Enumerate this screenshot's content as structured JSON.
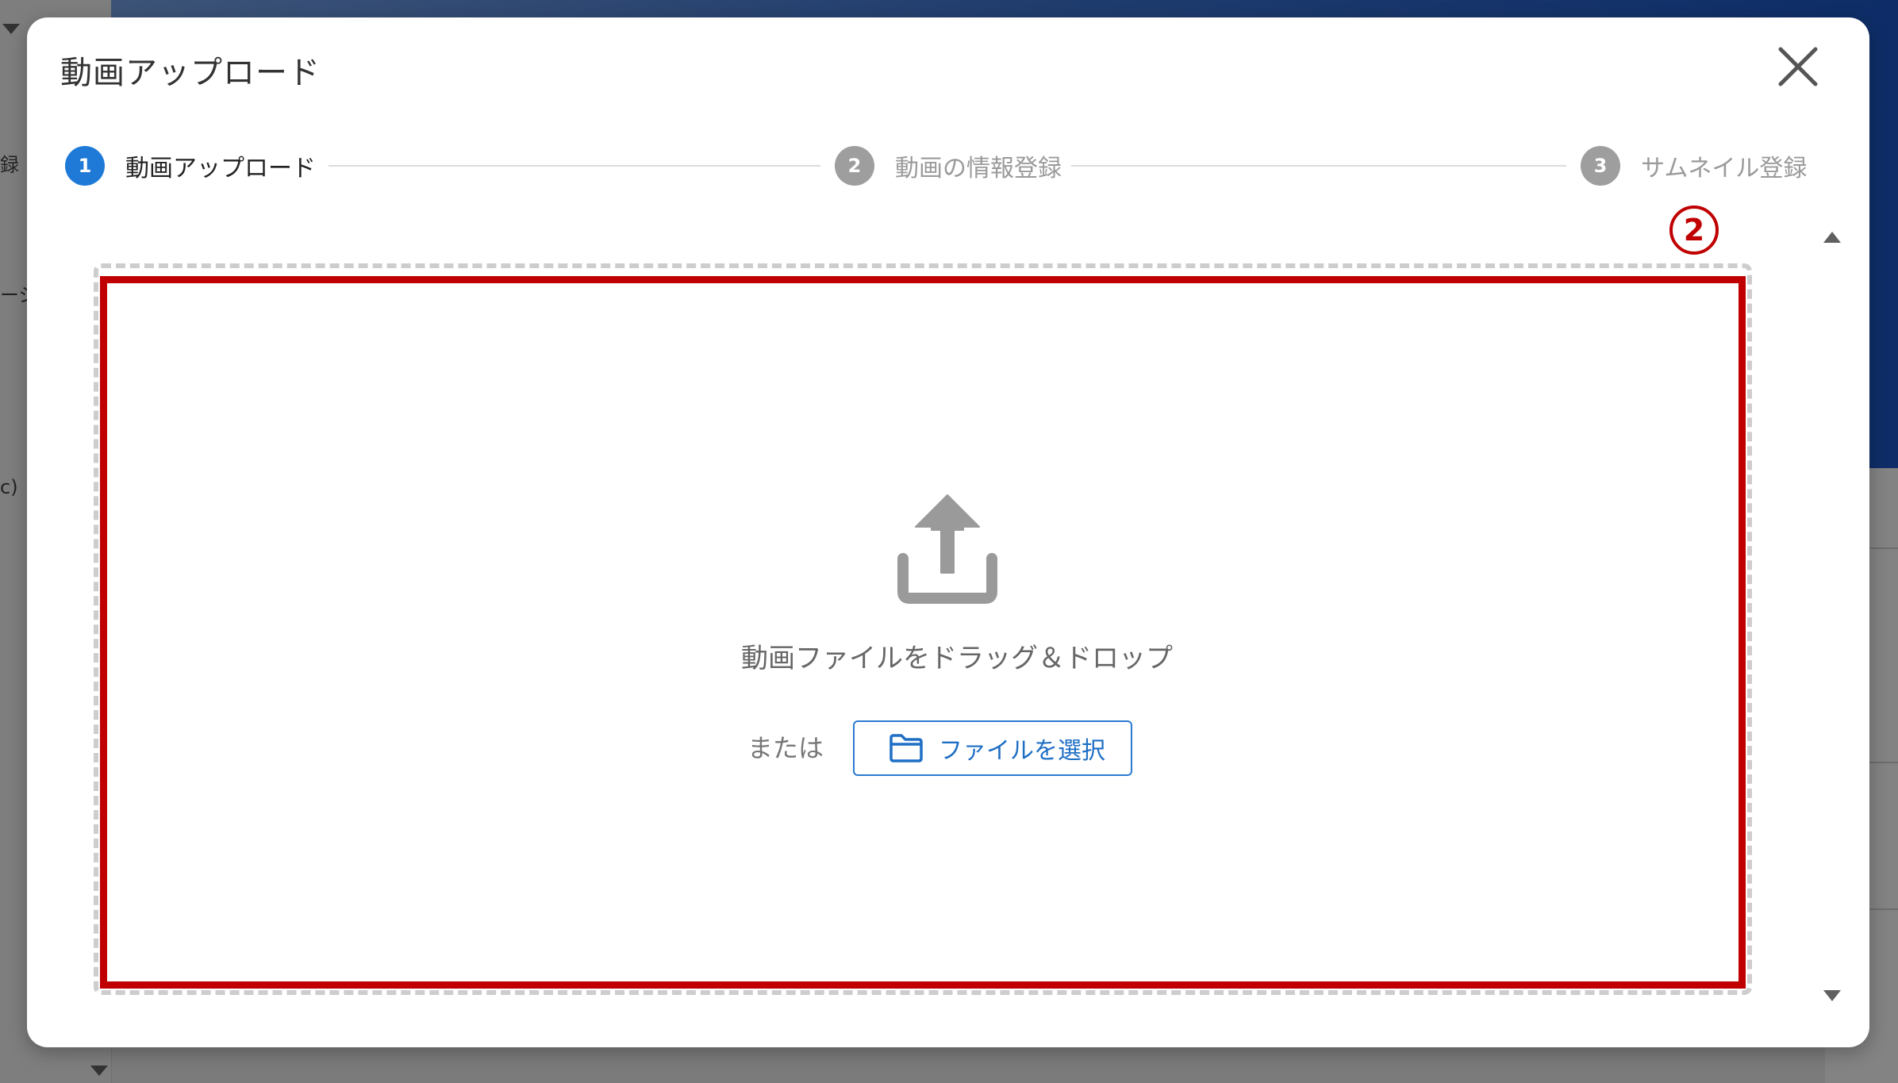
{
  "background": {
    "fragments": [
      "録",
      "ージ",
      "c)"
    ]
  },
  "dialog": {
    "title": "動画アップロード",
    "close_icon": "close-icon"
  },
  "stepper": {
    "steps": [
      {
        "number": "1",
        "label": "動画アップロード",
        "state": "active",
        "color": "#1e7ad6"
      },
      {
        "number": "2",
        "label": "動画の情報登録",
        "state": "inactive",
        "color": "#9e9e9e"
      },
      {
        "number": "3",
        "label": "サムネイル登録",
        "state": "inactive",
        "color": "#9e9e9e"
      }
    ]
  },
  "dropzone": {
    "icon": "upload-icon",
    "drag_text": "動画ファイルをドラッグ＆ドロップ",
    "or_text": "または",
    "select_button_label": "ファイルを選択",
    "select_button_icon": "folder-icon"
  },
  "annotation": {
    "marker": "2",
    "highlight_color": "#c00000"
  }
}
